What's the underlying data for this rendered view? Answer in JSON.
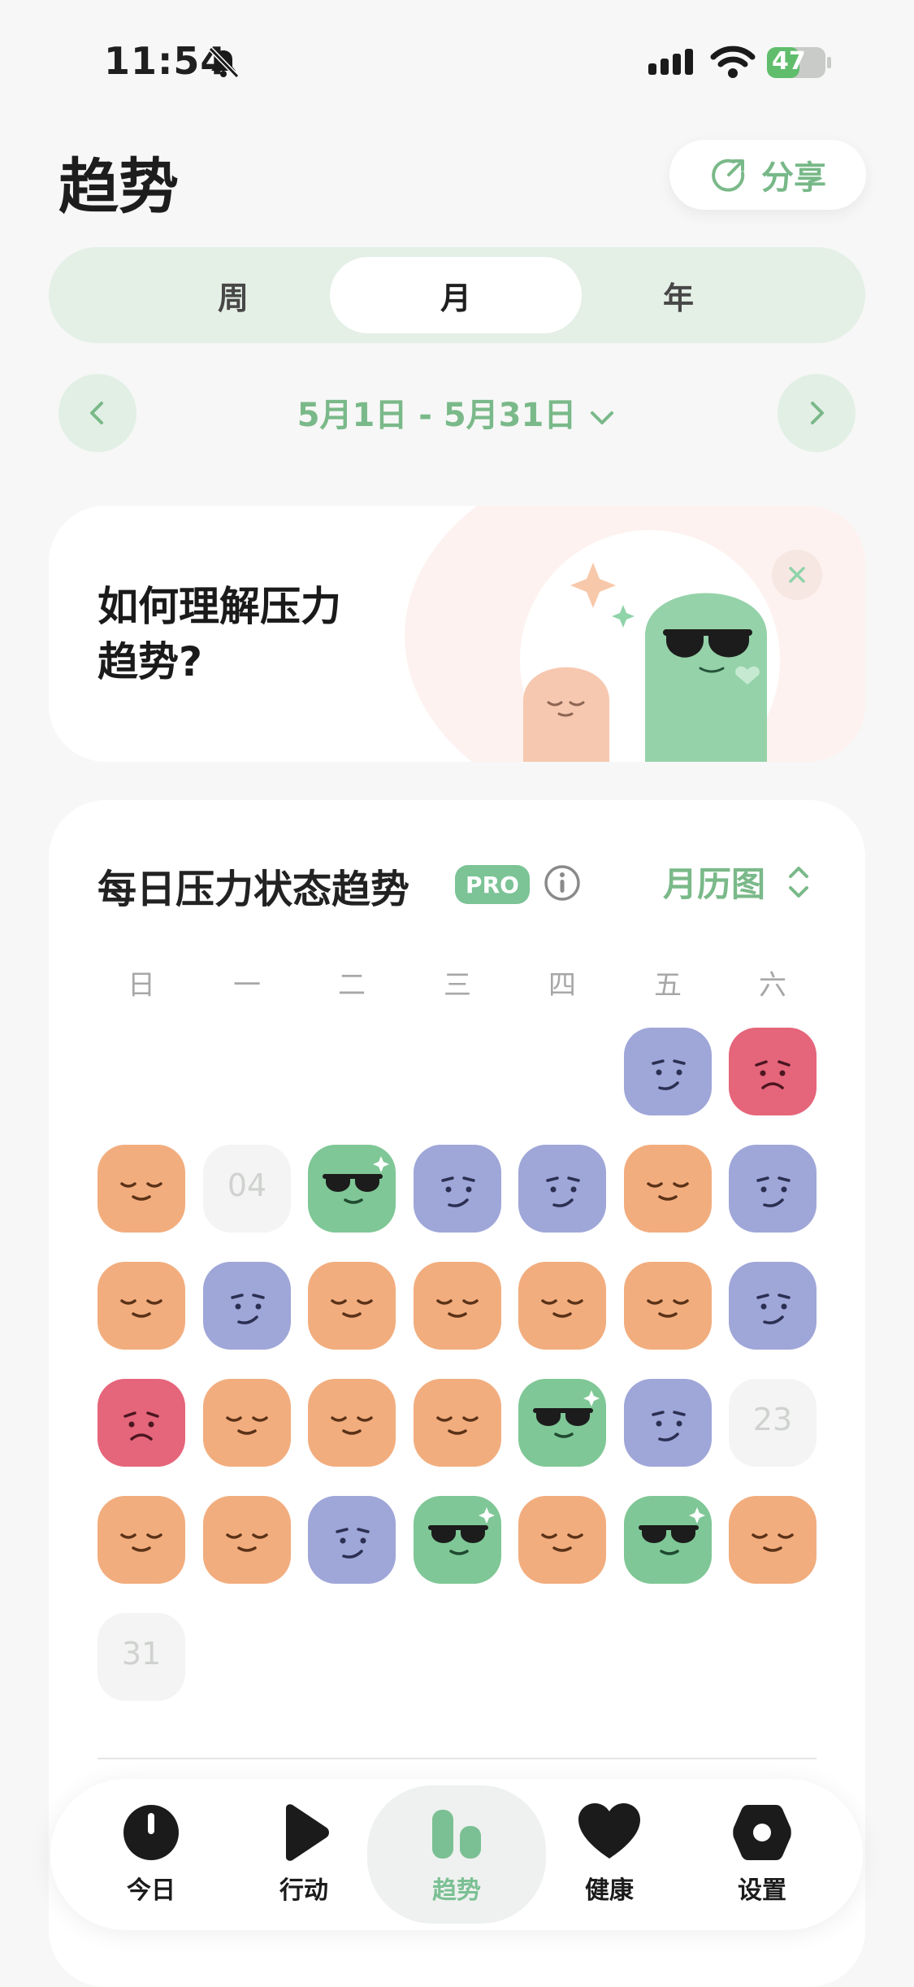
{
  "status_bar": {
    "time": "11:54",
    "battery": "47"
  },
  "header": {
    "title": "趋势",
    "share_label": "分享"
  },
  "segments": [
    {
      "label": "周"
    },
    {
      "label": "月",
      "active": true
    },
    {
      "label": "年"
    }
  ],
  "date_range": {
    "label": "5月1日 - 5月31日"
  },
  "promo": {
    "line1": "如何理解压力",
    "line2": "趋势?"
  },
  "calendar": {
    "title": "每日压力状态趋势",
    "pro": "PRO",
    "view_label": "月历图",
    "weekdays": [
      "日",
      "一",
      "二",
      "三",
      "四",
      "五",
      "六"
    ],
    "empty_days": [
      "04",
      "23",
      "31"
    ]
  },
  "colors": {
    "accent": "#7ab989",
    "orange": "#f2ad7e",
    "purple": "#9fa6d8",
    "green": "#7fc796",
    "red": "#e5657a"
  },
  "tabbar": [
    {
      "label": "今日",
      "icon": "clock-icon"
    },
    {
      "label": "行动",
      "icon": "play-icon"
    },
    {
      "label": "趋势",
      "icon": "chart-icon",
      "active": true
    },
    {
      "label": "健康",
      "icon": "heart-icon"
    },
    {
      "label": "设置",
      "icon": "settings-icon"
    }
  ]
}
